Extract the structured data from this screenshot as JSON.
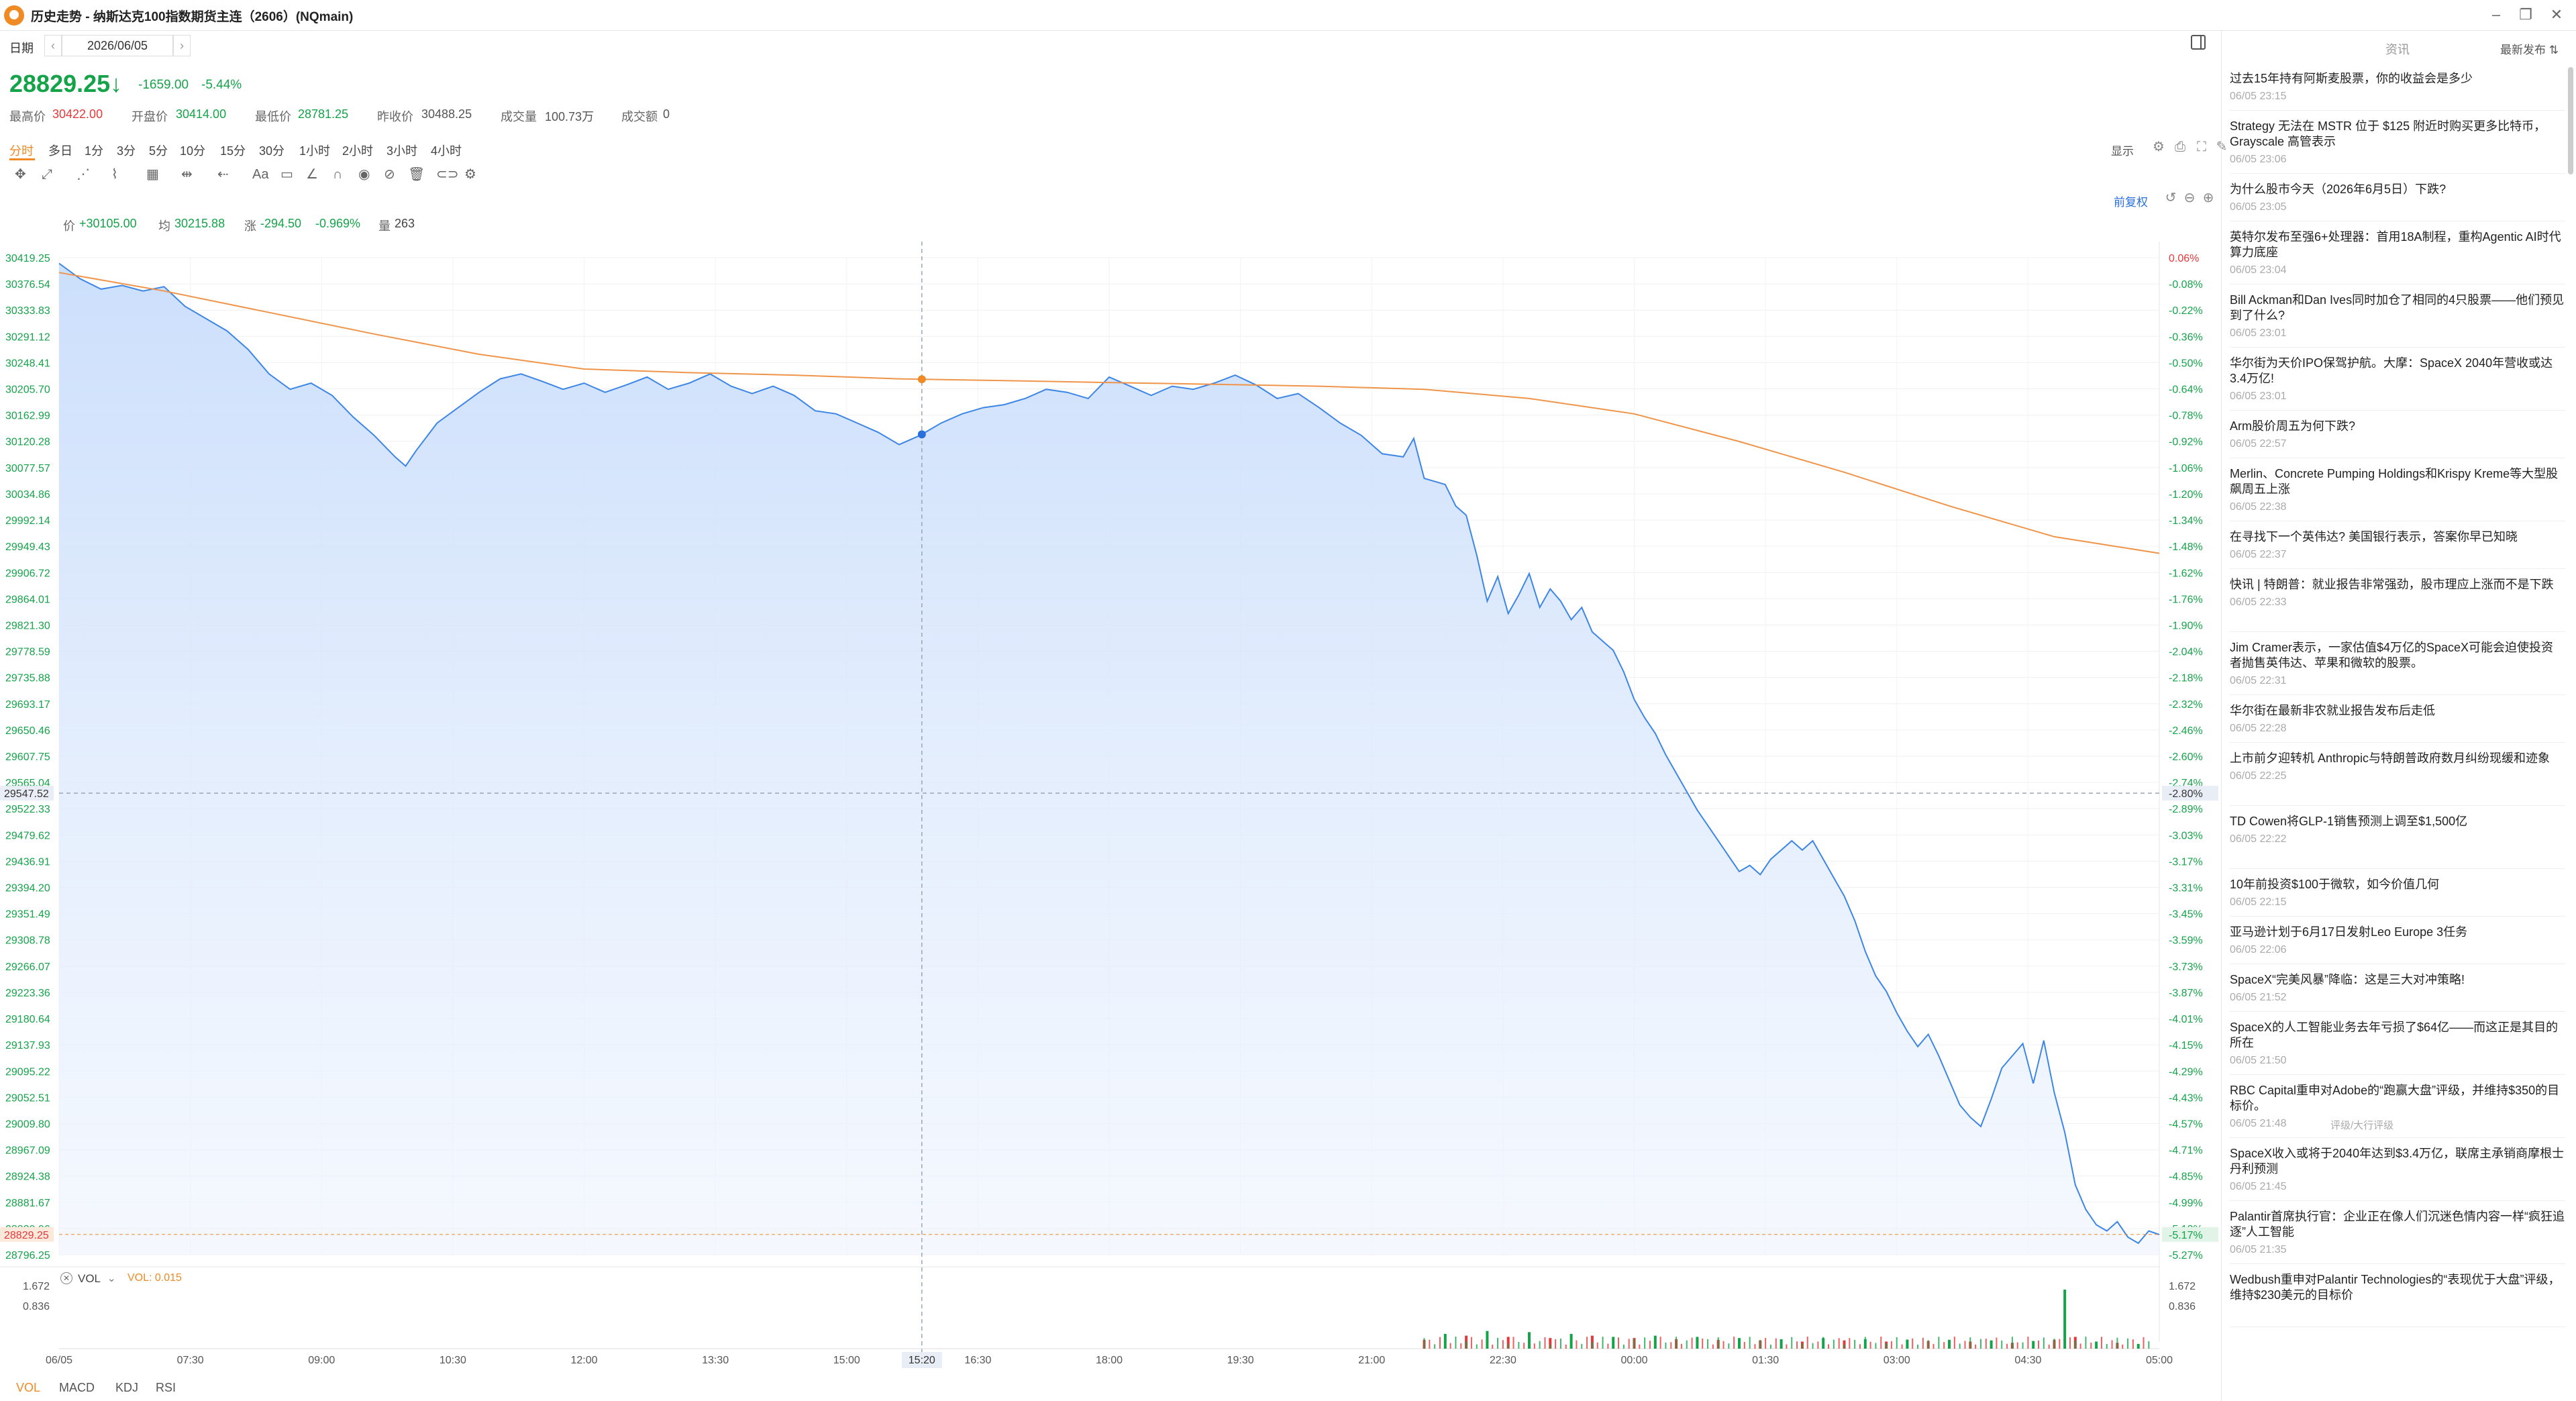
{
  "window": {
    "title": "历史走势 - 纳斯达克100指数期货主连（2606）(NQmain)"
  },
  "date_bar": {
    "label": "日期",
    "prev": "‹",
    "date": "2026/06/05",
    "next": "›"
  },
  "quote": {
    "last_price": "28829.25",
    "arrow": "↓",
    "change": "-1659.00",
    "change_pct": "-5.44%",
    "high_label": "最高价",
    "high": "30422.00",
    "open_label": "开盘价",
    "open": "30414.00",
    "low_label": "最低价",
    "low": "28781.25",
    "prev_close_label": "昨收价",
    "prev_close": "30488.25",
    "volume_label": "成交量",
    "volume": "100.73万",
    "turnover_label": "成交额",
    "turnover": "0"
  },
  "periods": [
    "分时",
    "多日",
    "1分",
    "3分",
    "5分",
    "10分",
    "15分",
    "30分",
    "1小时",
    "2小时",
    "3小时",
    "4小时"
  ],
  "active_period": "分时",
  "display_label": "显示",
  "indicator_line": {
    "price_label": "价",
    "price": "+30105.00",
    "avg_label": "均",
    "avg": "30215.88",
    "chg_label": "涨",
    "chg": "-294.50",
    "chg_pct": "-0.969%",
    "vol_label": "量",
    "vol": "263"
  },
  "adjust_label": "前复权",
  "chart_data": {
    "type": "line",
    "price_axis": [
      "30419.25",
      "30376.54",
      "30333.83",
      "30291.12",
      "30248.41",
      "30205.70",
      "30162.99",
      "30120.28",
      "30077.57",
      "30034.86",
      "29992.14",
      "29949.43",
      "29906.72",
      "29864.01",
      "29821.30",
      "29778.59",
      "29735.88",
      "29693.17",
      "29650.46",
      "29607.75",
      "29565.04",
      "29522.33",
      "29479.62",
      "29436.91",
      "29394.20",
      "29351.49",
      "29308.78",
      "29266.07",
      "29223.36",
      "29180.64",
      "29137.93",
      "29095.22",
      "29052.51",
      "29009.80",
      "28967.09",
      "28924.38",
      "28881.67",
      "28839.96",
      "28796.25"
    ],
    "pct_axis": [
      "0.06%",
      "-0.08%",
      "-0.22%",
      "-0.36%",
      "-0.50%",
      "-0.64%",
      "-0.78%",
      "-0.92%",
      "-1.06%",
      "-1.20%",
      "-1.34%",
      "-1.48%",
      "-1.62%",
      "-1.76%",
      "-1.90%",
      "-2.04%",
      "-2.18%",
      "-2.32%",
      "-2.46%",
      "-2.60%",
      "-2.74%",
      "-2.89%",
      "-3.03%",
      "-3.17%",
      "-3.31%",
      "-3.45%",
      "-3.59%",
      "-3.73%",
      "-3.87%",
      "-4.01%",
      "-4.15%",
      "-4.29%",
      "-4.43%",
      "-4.57%",
      "-4.71%",
      "-4.85%",
      "-4.99%",
      "-5.13%",
      "-5.27%"
    ],
    "crosshair_price": "29547.52",
    "crosshair_pct": "-2.80%",
    "last_price_tag": "28829.25",
    "last_pct_tag": "-5.17%",
    "x_ticks": [
      "06/05",
      "07:30",
      "09:00",
      "10:30",
      "12:00",
      "13:30",
      "15:00",
      "16:30",
      "18:00",
      "19:30",
      "21:00",
      "22:30",
      "00:00",
      "01:30",
      "03:00",
      "04:30",
      "05:00"
    ],
    "crosshair_time": "15:20",
    "ylim": [
      28796.25,
      30419.25
    ],
    "price_series": [
      [
        0,
        30410
      ],
      [
        0.01,
        30385
      ],
      [
        0.02,
        30368
      ],
      [
        0.03,
        30374
      ],
      [
        0.04,
        30365
      ],
      [
        0.05,
        30372
      ],
      [
        0.06,
        30340
      ],
      [
        0.07,
        30320
      ],
      [
        0.08,
        30300
      ],
      [
        0.09,
        30270
      ],
      [
        0.1,
        30230
      ],
      [
        0.11,
        30205
      ],
      [
        0.12,
        30215
      ],
      [
        0.13,
        30195
      ],
      [
        0.14,
        30160
      ],
      [
        0.15,
        30130
      ],
      [
        0.16,
        30095
      ],
      [
        0.165,
        30080
      ],
      [
        0.17,
        30105
      ],
      [
        0.18,
        30150
      ],
      [
        0.19,
        30175
      ],
      [
        0.2,
        30200
      ],
      [
        0.21,
        30222
      ],
      [
        0.22,
        30230
      ],
      [
        0.23,
        30218
      ],
      [
        0.24,
        30205
      ],
      [
        0.25,
        30215
      ],
      [
        0.26,
        30200
      ],
      [
        0.27,
        30212
      ],
      [
        0.28,
        30225
      ],
      [
        0.29,
        30205
      ],
      [
        0.3,
        30215
      ],
      [
        0.31,
        30230
      ],
      [
        0.32,
        30210
      ],
      [
        0.33,
        30198
      ],
      [
        0.34,
        30210
      ],
      [
        0.35,
        30195
      ],
      [
        0.36,
        30170
      ],
      [
        0.37,
        30165
      ],
      [
        0.38,
        30150
      ],
      [
        0.39,
        30135
      ],
      [
        0.4,
        30115
      ],
      [
        0.41,
        30130
      ],
      [
        0.42,
        30150
      ],
      [
        0.43,
        30165
      ],
      [
        0.44,
        30175
      ],
      [
        0.45,
        30180
      ],
      [
        0.46,
        30190
      ],
      [
        0.47,
        30205
      ],
      [
        0.48,
        30200
      ],
      [
        0.49,
        30190
      ],
      [
        0.5,
        30225
      ],
      [
        0.51,
        30210
      ],
      [
        0.52,
        30195
      ],
      [
        0.53,
        30210
      ],
      [
        0.54,
        30205
      ],
      [
        0.55,
        30215
      ],
      [
        0.56,
        30228
      ],
      [
        0.57,
        30212
      ],
      [
        0.58,
        30190
      ],
      [
        0.59,
        30198
      ],
      [
        0.6,
        30175
      ],
      [
        0.61,
        30150
      ],
      [
        0.62,
        30130
      ],
      [
        0.63,
        30100
      ],
      [
        0.64,
        30095
      ],
      [
        0.645,
        30125
      ],
      [
        0.65,
        30060
      ],
      [
        0.66,
        30050
      ],
      [
        0.665,
        30015
      ],
      [
        0.67,
        30000
      ],
      [
        0.675,
        29935
      ],
      [
        0.68,
        29860
      ],
      [
        0.685,
        29900
      ],
      [
        0.69,
        29840
      ],
      [
        0.695,
        29870
      ],
      [
        0.7,
        29905
      ],
      [
        0.705,
        29850
      ],
      [
        0.71,
        29880
      ],
      [
        0.715,
        29860
      ],
      [
        0.72,
        29830
      ],
      [
        0.725,
        29850
      ],
      [
        0.73,
        29810
      ],
      [
        0.735,
        29795
      ],
      [
        0.74,
        29780
      ],
      [
        0.745,
        29745
      ],
      [
        0.75,
        29700
      ],
      [
        0.755,
        29670
      ],
      [
        0.76,
        29645
      ],
      [
        0.765,
        29610
      ],
      [
        0.77,
        29580
      ],
      [
        0.775,
        29550
      ],
      [
        0.78,
        29520
      ],
      [
        0.785,
        29495
      ],
      [
        0.79,
        29470
      ],
      [
        0.795,
        29445
      ],
      [
        0.8,
        29420
      ],
      [
        0.805,
        29430
      ],
      [
        0.81,
        29415
      ],
      [
        0.815,
        29440
      ],
      [
        0.82,
        29455
      ],
      [
        0.825,
        29470
      ],
      [
        0.83,
        29455
      ],
      [
        0.835,
        29470
      ],
      [
        0.84,
        29440
      ],
      [
        0.845,
        29410
      ],
      [
        0.85,
        29380
      ],
      [
        0.855,
        29340
      ],
      [
        0.86,
        29290
      ],
      [
        0.865,
        29250
      ],
      [
        0.87,
        29225
      ],
      [
        0.875,
        29190
      ],
      [
        0.88,
        29160
      ],
      [
        0.885,
        29135
      ],
      [
        0.89,
        29155
      ],
      [
        0.895,
        29120
      ],
      [
        0.9,
        29080
      ],
      [
        0.905,
        29040
      ],
      [
        0.91,
        29020
      ],
      [
        0.915,
        29005
      ],
      [
        0.92,
        29050
      ],
      [
        0.925,
        29100
      ],
      [
        0.93,
        29120
      ],
      [
        0.935,
        29140
      ],
      [
        0.94,
        29075
      ],
      [
        0.945,
        29145
      ],
      [
        0.95,
        29060
      ],
      [
        0.955,
        28995
      ],
      [
        0.96,
        28910
      ],
      [
        0.965,
        28870
      ],
      [
        0.97,
        28845
      ],
      [
        0.975,
        28835
      ],
      [
        0.98,
        28850
      ],
      [
        0.985,
        28825
      ],
      [
        0.99,
        28815
      ],
      [
        0.995,
        28835
      ],
      [
        1,
        28829
      ]
    ],
    "avg_series": [
      [
        0,
        30395
      ],
      [
        0.05,
        30365
      ],
      [
        0.1,
        30330
      ],
      [
        0.15,
        30295
      ],
      [
        0.2,
        30262
      ],
      [
        0.25,
        30238
      ],
      [
        0.3,
        30232
      ],
      [
        0.35,
        30228
      ],
      [
        0.4,
        30222
      ],
      [
        0.45,
        30219
      ],
      [
        0.5,
        30216
      ],
      [
        0.55,
        30213
      ],
      [
        0.6,
        30210
      ],
      [
        0.65,
        30205
      ],
      [
        0.7,
        30190
      ],
      [
        0.75,
        30165
      ],
      [
        0.8,
        30120
      ],
      [
        0.85,
        30070
      ],
      [
        0.9,
        30015
      ],
      [
        0.95,
        29965
      ],
      [
        1,
        29938
      ]
    ],
    "volume_axis": [
      "1.672",
      "0.836"
    ],
    "volume_label": "VOL",
    "volume_value": "VOL: 0.015",
    "volume_points": [
      [
        0.65,
        0.15
      ],
      [
        0.66,
        0.25
      ],
      [
        0.67,
        0.22
      ],
      [
        0.68,
        0.3
      ],
      [
        0.69,
        0.2
      ],
      [
        0.7,
        0.28
      ],
      [
        0.71,
        0.18
      ],
      [
        0.72,
        0.25
      ],
      [
        0.73,
        0.22
      ],
      [
        0.74,
        0.2
      ],
      [
        0.75,
        0.18
      ],
      [
        0.76,
        0.22
      ],
      [
        0.77,
        0.16
      ],
      [
        0.78,
        0.2
      ],
      [
        0.79,
        0.15
      ],
      [
        0.8,
        0.18
      ],
      [
        0.81,
        0.14
      ],
      [
        0.82,
        0.16
      ],
      [
        0.83,
        0.12
      ],
      [
        0.84,
        0.18
      ],
      [
        0.85,
        0.14
      ],
      [
        0.86,
        0.16
      ],
      [
        0.87,
        0.12
      ],
      [
        0.88,
        0.15
      ],
      [
        0.89,
        0.13
      ],
      [
        0.9,
        0.15
      ],
      [
        0.91,
        0.12
      ],
      [
        0.92,
        0.14
      ],
      [
        0.93,
        0.1
      ],
      [
        0.94,
        0.13
      ],
      [
        0.95,
        0.15
      ],
      [
        0.955,
        1.0
      ],
      [
        0.96,
        0.2
      ],
      [
        0.97,
        0.12
      ],
      [
        0.98,
        0.1
      ],
      [
        0.99,
        0.08
      ]
    ]
  },
  "bottom_tabs": [
    "VOL",
    "MACD",
    "KDJ",
    "RSI"
  ],
  "news": {
    "tab": "资讯",
    "latest": "最新发布",
    "items": [
      {
        "title": "过去15年持有阿斯麦股票，你的收益会是多少",
        "time": "06/05 23:15"
      },
      {
        "title": "Strategy 无法在 MSTR 位于 $125 附近时购买更多比特币，Grayscale 高管表示",
        "time": "06/05 23:06"
      },
      {
        "title": "为什么股市今天（2026年6月5日）下跌?",
        "time": "06/05 23:05"
      },
      {
        "title": "英特尔发布至强6+处理器：首用18A制程，重构Agentic AI时代算力底座",
        "time": "06/05 23:04"
      },
      {
        "title": "Bill Ackman和Dan Ives同时加仓了相同的4只股票——他们预见到了什么?",
        "time": "06/05 23:01"
      },
      {
        "title": "华尔街为天价IPO保驾护航。大摩：SpaceX 2040年营收或达3.4万亿!",
        "time": "06/05 23:01"
      },
      {
        "title": "Arm股价周五为何下跌?",
        "time": "06/05 22:57"
      },
      {
        "title": "Merlin、Concrete Pumping Holdings和Krispy Kreme等大型股飙周五上涨",
        "time": "06/05 22:38"
      },
      {
        "title": "在寻找下一个英伟达? 美国银行表示，答案你早已知晓",
        "time": "06/05 22:37"
      },
      {
        "title": "快讯 | 特朗普：就业报告非常强劲，股市理应上涨而不是下跌",
        "time": "06/05 22:33"
      },
      {
        "title": "Jim Cramer表示，一家估值$4万亿的SpaceX可能会迫使投资者抛售英伟达、苹果和微软的股票。",
        "time": "06/05 22:31"
      },
      {
        "title": "华尔街在最新非农就业报告发布后走低",
        "time": "06/05 22:28"
      },
      {
        "title": "上市前夕迎转机 Anthropic与特朗普政府数月纠纷现缓和迹象",
        "time": "06/05 22:25"
      },
      {
        "title": "TD Cowen将GLP-1销售预测上调至$1,500亿",
        "time": "06/05 22:22"
      },
      {
        "title": "10年前投资$100于微软，如今价值几何",
        "time": "06/05 22:15"
      },
      {
        "title": "亚马逊计划于6月17日发射Leo Europe 3任务",
        "time": "06/05 22:06"
      },
      {
        "title": "SpaceX“完美风暴”降临：这是三大对冲策略!",
        "time": "06/05 21:52"
      },
      {
        "title": "SpaceX的人工智能业务去年亏损了$64亿——而这正是其目的所在",
        "time": "06/05 21:50"
      },
      {
        "title": "RBC Capital重申对Adobe的“跑赢大盘”评级，并维持$350的目标价。",
        "time": "06/05 21:48",
        "tag": "评级/大行评级"
      },
      {
        "title": "SpaceX收入或将于2040年达到$3.4万亿，联席主承销商摩根士丹利预测",
        "time": "06/05 21:45"
      },
      {
        "title": "Palantir首席执行官：企业正在像人们沉迷色情内容一样“疯狂追逐”人工智能",
        "time": "06/05 21:35"
      },
      {
        "title": "Wedbush重申对Palantir Technologies的“表现优于大盘”评级，维持$230美元的目标价",
        "time": ""
      }
    ]
  },
  "colors": {
    "up": "#e5383b",
    "down": "#15a34a",
    "accent": "#f08a24",
    "price_line": "#3d86e6",
    "avg_line": "#f0944a"
  }
}
